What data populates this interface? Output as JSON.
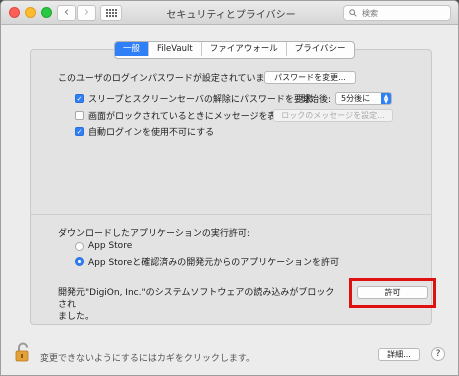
{
  "window": {
    "title": "セキュリティとプライバシー",
    "search_placeholder": "検索",
    "nav_back": "‹",
    "nav_forward": "›"
  },
  "tabs": [
    {
      "label": "一般",
      "active": true
    },
    {
      "label": "FileVault",
      "active": false
    },
    {
      "label": "ファイアウォール",
      "active": false
    },
    {
      "label": "プライバシー",
      "active": false
    }
  ],
  "general": {
    "password_text": "このユーザのログインパスワードが設定されています",
    "change_password_label": "パスワードを変更...",
    "require_password_label": "スリープとスクリーンセーバの解除にパスワードを要求",
    "require_password_checked": true,
    "start_after_label": "開始後:",
    "start_after_value": "5分後に",
    "show_message_label": "画面がロックされているときにメッセージを表示",
    "show_message_checked": false,
    "lock_message_label": "ロックのメッセージを設定...",
    "disable_autologin_label": "自動ログインを使用不可にする",
    "disable_autologin_checked": true
  },
  "downloads": {
    "heading": "ダウンロードしたアプリケーションの実行許可:",
    "option_appstore": "App Store",
    "option_appstore_devs": "App Storeと確認済みの開発元からのアプリケーションを許可",
    "selected": "option_appstore_devs",
    "blocked_message_line1": "開発元\"DigiOn, Inc.\"のシステムソフトウェアの読み込みがブロックされ",
    "blocked_message_line2": "ました。",
    "allow_label": "許可"
  },
  "footer": {
    "lock_text": "変更できないようにするにはカギをクリックします。",
    "advanced_label": "詳細...",
    "help_label": "?"
  },
  "colors": {
    "accent": "#2f7ff6",
    "highlight_box": "#e01010"
  },
  "icons": [
    "lock-icon",
    "search-icon",
    "grid-icon",
    "chevron-down-icon",
    "checkmark-icon"
  ]
}
